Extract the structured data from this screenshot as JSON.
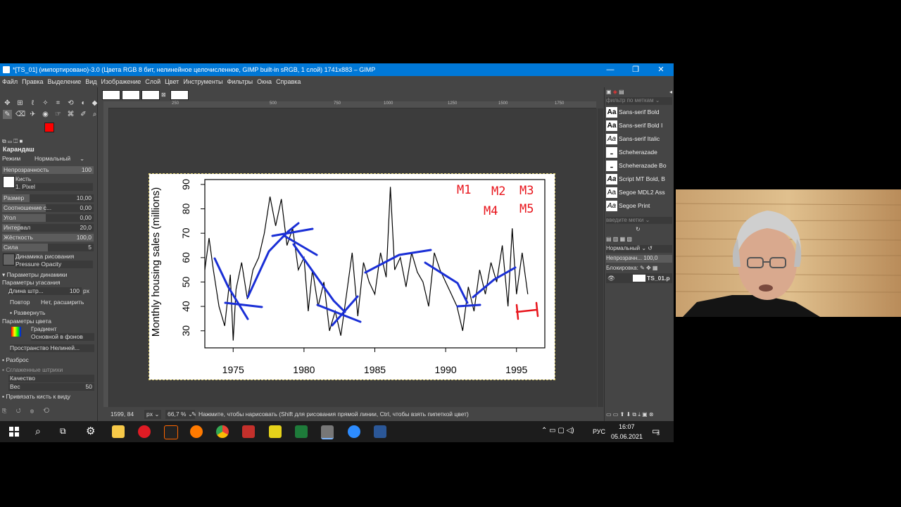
{
  "window": {
    "title": "*[TS_01] (импортировано)-3.0 (Цвета RGB 8 бит, нелинейное целочисленное, GIMP built-in sRGB, 1 слой) 1741x883 – GIMP",
    "minimize": "—",
    "maximize": "❐",
    "close": "✕"
  },
  "menu": [
    "Файл",
    "Правка",
    "Выделение",
    "Вид",
    "Изображение",
    "Слой",
    "Цвет",
    "Инструменты",
    "Фильтры",
    "Окна",
    "Справка"
  ],
  "toolbox": {
    "tool_title": "Карандаш",
    "mode_label": "Режим",
    "mode_value": "Нормальный",
    "opacity_label": "Непрозрачность",
    "opacity_value": "100",
    "opacity_fraction": 1.0,
    "brush_label": "Кисть",
    "brush_value": "1. Pixel",
    "size_label": "Размер",
    "size_value": "10,00",
    "aspect_label": "Соотношение с...",
    "aspect_value": "0,00",
    "angle_label": "Угол",
    "angle_value": "0,00",
    "spacing_label": "Интервал",
    "spacing_value": "20,0",
    "hardness_label": "Жёсткость",
    "hardness_value": "100,0",
    "force_label": "Сила",
    "force_value": "5",
    "dynamics_label": "Динамика рисования",
    "dynamics_value": "Pressure Opacity",
    "dyn_params": "Параметры динамики",
    "fade_params": "Параметры угасания",
    "fade_length_label": "Длина штр...",
    "fade_length_value": "100",
    "fade_unit": "px",
    "repeat_label": "Повтор",
    "repeat_value": "Нет, расширить",
    "reverse_label": "Развернуть",
    "color_params": "Параметры цвета",
    "gradient_label": "Градиент",
    "gradient_value": "Основной в фонов",
    "space_label": "Пространство Нелиней...",
    "scatter_label": "Разброс",
    "smooth_label": "Сглаженные штрихи",
    "quality_label": "Качество",
    "weight_label": "Вес",
    "weight_value": "50",
    "snap_label": "Привязать кисть к виду"
  },
  "rulers": [
    "250",
    "500",
    "750",
    "1000",
    "1250",
    "1500",
    "1750"
  ],
  "chart_data": {
    "type": "line",
    "ylabel": "Monthly housing sales (millions)",
    "xticks": [
      "1975",
      "1980",
      "1985",
      "1990",
      "1995"
    ],
    "yticks": [
      "30",
      "40",
      "50",
      "60",
      "70",
      "80",
      "90"
    ],
    "xlim": [
      1973,
      1997
    ],
    "ylim": [
      23,
      92
    ],
    "series": [
      {
        "x": [
          1973,
          1973.3,
          1973.6,
          1974,
          1974.4,
          1974.8,
          1975,
          1975.2,
          1975.6,
          1976,
          1976.4,
          1976.8,
          1977.2,
          1977.6,
          1978,
          1978.4,
          1978.8,
          1979.2,
          1979.6,
          1980,
          1980.3,
          1980.6,
          1981,
          1981.4,
          1981.8,
          1982.2,
          1982.6,
          1983,
          1983.4,
          1983.8,
          1984.2,
          1984.6,
          1985,
          1985.4,
          1985.8,
          1986.1,
          1986.4,
          1986.8,
          1987.2,
          1987.6,
          1988,
          1988.4,
          1988.8,
          1989.2,
          1989.6,
          1990,
          1990.4,
          1990.8,
          1991.2,
          1991.6,
          1992,
          1992.4,
          1992.8,
          1993.2,
          1993.6,
          1994,
          1994.4,
          1994.7,
          1995,
          1995.4,
          1995.8
        ],
        "values": [
          55,
          68,
          55,
          40,
          32,
          53,
          26,
          47,
          58,
          43,
          55,
          60,
          70,
          85,
          73,
          84,
          65,
          72,
          55,
          60,
          38,
          55,
          40,
          50,
          30,
          38,
          28,
          45,
          62,
          36,
          58,
          50,
          45,
          62,
          52,
          89,
          55,
          60,
          48,
          62,
          54,
          50,
          40,
          62,
          55,
          50,
          45,
          40,
          30,
          48,
          38,
          55,
          45,
          58,
          50,
          65,
          40,
          72,
          45,
          62,
          45
        ]
      }
    ],
    "annotations": [
      "M1",
      "M2",
      "M3",
      "M4",
      "M5"
    ]
  },
  "rightpanel": {
    "filter_placeholder": "фильтр по меткам",
    "fonts": [
      "Sans-serif Bold",
      "Sans-serif Bold I",
      "Sans-serif Italic",
      "Scheherazade",
      "Scheherazade Bo",
      "Script MT Bold, B",
      "Segoe MDL2 Ass",
      "Segoe Print"
    ],
    "tags_placeholder": "введите метки",
    "layer_mode": "Нормальный",
    "layer_opacity_label": "Непрозрачн...",
    "layer_opacity_value": "100,0",
    "lock_label": "Блокировка:",
    "layer_name": "TS_01.p"
  },
  "status": {
    "coords": "1599, 84",
    "unit": "px",
    "zoom": "66,7 %",
    "message": "Нажмите, чтобы нарисовать (Shift для рисования прямой линии, Ctrl, чтобы взять пипеткой цвет)"
  },
  "taskbar": {
    "lang": "РУС",
    "time": "16:07",
    "date": "05.06.2021",
    "notif": "3"
  },
  "colors": {
    "titlebar": "#0078d7",
    "fg_color": "#ff0000",
    "pen_blue": "#1a2fd6",
    "pen_red": "#e8141b"
  }
}
